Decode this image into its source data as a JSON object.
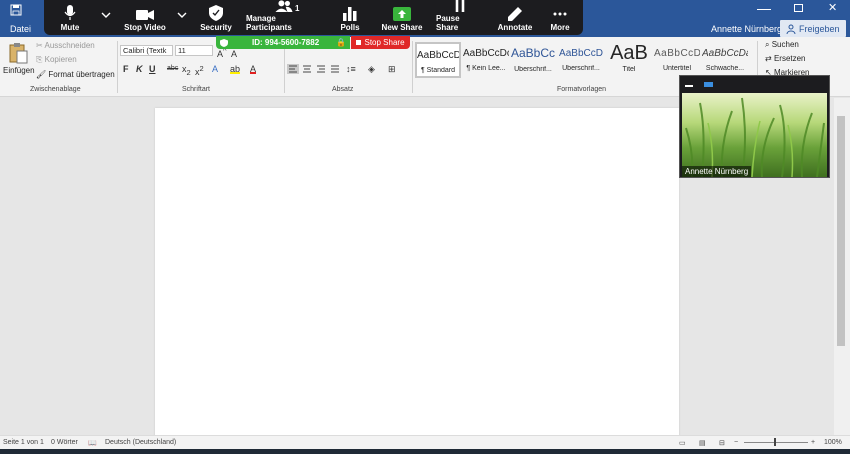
{
  "titlebar": {
    "file_tab": "Datei",
    "user_name": "Annette Nürnberg",
    "share_label": "Freigeben"
  },
  "zoom": {
    "mute": "Mute",
    "stop_video": "Stop Video",
    "security": "Security",
    "participants": "Manage Participants",
    "participants_count": "1",
    "polls": "Polls",
    "new_share": "New Share",
    "pause_share": "Pause Share",
    "annotate": "Annotate",
    "more": "More",
    "meeting_id": "ID: 994-5600-7882",
    "stop_share": "Stop Share",
    "accent_green": "#39b53c",
    "accent_red": "#e02828"
  },
  "ribbon": {
    "clipboard": {
      "paste": "Einfügen",
      "cut": "Ausschneiden",
      "copy": "Kopieren",
      "format_painter": "Format übertragen",
      "label": "Zwischenablage"
    },
    "font": {
      "family": "Calibri (Textk",
      "size": "11",
      "label": "Schriftart"
    },
    "paragraph": {
      "label": "Absatz"
    },
    "styles": {
      "label": "Formatvorlagen",
      "items": [
        {
          "preview": "AaBbCcDc",
          "name": "¶ Standard"
        },
        {
          "preview": "AaBbCcDc",
          "name": "¶ Kein Lee..."
        },
        {
          "preview": "AaBbCc",
          "name": "Überschrif..."
        },
        {
          "preview": "AaBbCcD",
          "name": "Überschrif..."
        },
        {
          "preview": "AaB",
          "name": "Titel"
        },
        {
          "preview": "AaBbCcD",
          "name": "Untertitel"
        },
        {
          "preview": "AaBbCcDa",
          "name": "Schwache..."
        }
      ]
    },
    "editing": {
      "find": "Suchen",
      "replace": "Ersetzen",
      "select": "Markieren"
    }
  },
  "video": {
    "name": "Annette Nürnberg"
  },
  "status": {
    "page": "Seite 1 von 1",
    "words": "0 Wörter",
    "language": "Deutsch (Deutschland)",
    "zoom": "100%"
  },
  "colors": {
    "word_blue": "#2b579a"
  }
}
